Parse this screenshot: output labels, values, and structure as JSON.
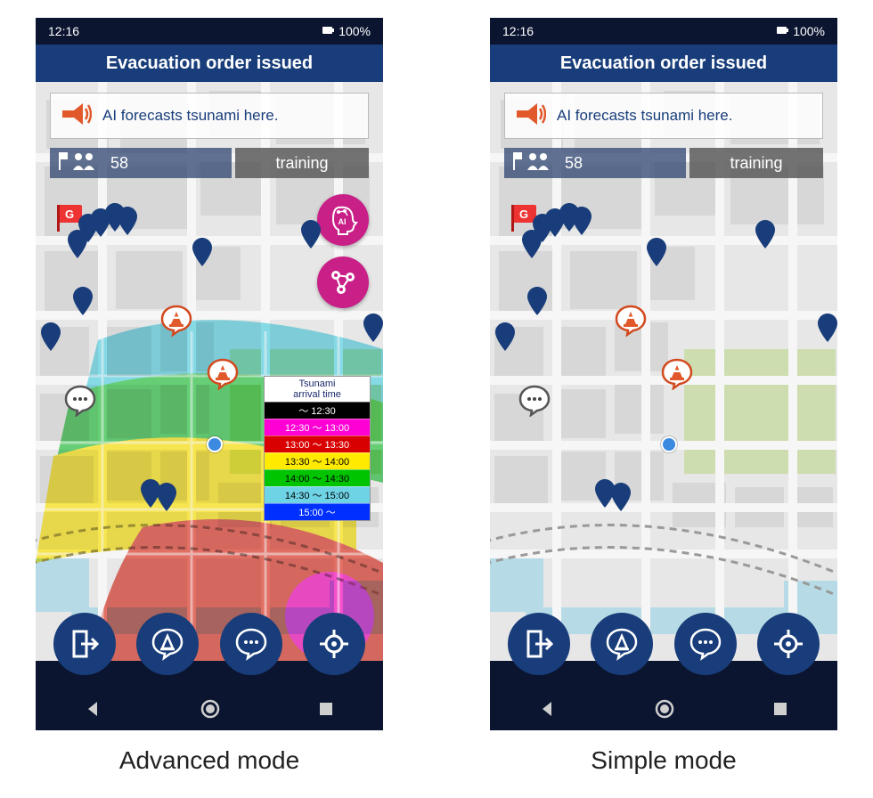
{
  "status": {
    "time": "12:16",
    "battery": "100%"
  },
  "header": {
    "title": "Evacuation order issued"
  },
  "alert": {
    "text": "AI forecasts tsunami here."
  },
  "info": {
    "count": "58",
    "mode_label": "training"
  },
  "legend": {
    "title_line1": "Tsunami",
    "title_line2": "arrival time",
    "rows": [
      {
        "label": "～ 12:30",
        "bg": "#000000",
        "fg": "#ffffff"
      },
      {
        "label": "12:30 ～ 13:00",
        "bg": "#ff00d4",
        "fg": "#ffffff"
      },
      {
        "label": "13:00 ～ 13:30",
        "bg": "#d80000",
        "fg": "#ffffff"
      },
      {
        "label": "13:30 ～ 14:00",
        "bg": "#ffea00",
        "fg": "#000000"
      },
      {
        "label": "14:00 ～ 14:30",
        "bg": "#00c400",
        "fg": "#000000"
      },
      {
        "label": "14:30 ～ 15:00",
        "bg": "#6fd3e6",
        "fg": "#000000"
      },
      {
        "label": "15:00 ～",
        "bg": "#0030ff",
        "fg": "#ffffff"
      }
    ]
  },
  "captions": {
    "advanced": "Advanced mode",
    "simple": "Simple mode"
  }
}
